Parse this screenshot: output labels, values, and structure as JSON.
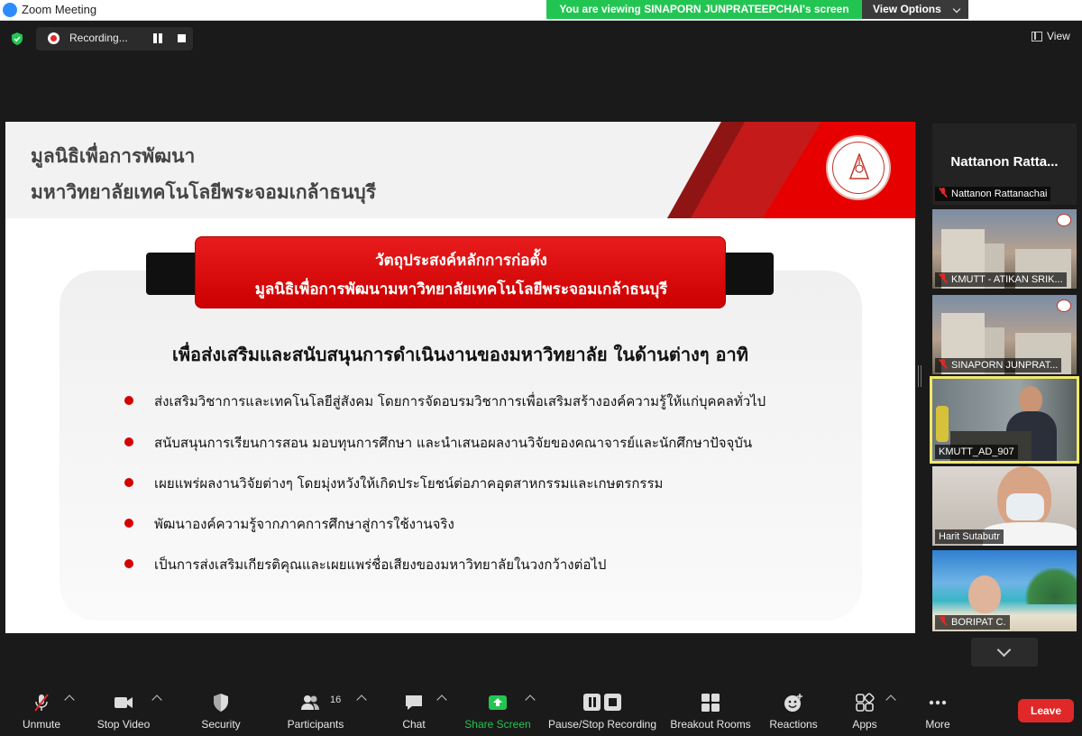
{
  "window": {
    "title": "Zoom Meeting"
  },
  "banner": {
    "viewing_text": "You are viewing SINAPORN   JUNPRATEEPCHAI's screen",
    "view_options_label": "View Options"
  },
  "recording": {
    "label": "Recording..."
  },
  "top_right": {
    "view_label": "View"
  },
  "slide": {
    "header_line1": "มูลนิธิเพื่อการพัฒนา",
    "header_line2": "มหาวิทยาลัยเทคโนโลยีพระจอมเกล้าธนบุรี",
    "red_line1": "วัตถุประสงค์หลักการก่อตั้ง",
    "red_line2": "มูลนิธิเพื่อการพัฒนามหาวิทยาลัยเทคโนโลยีพระจอมเกล้าธนบุรี",
    "lead": "เพื่อส่งเสริมและสนับสนุนการดำเนินงานของมหาวิทยาลัย ในด้านต่างๆ อาทิ",
    "bullets": [
      "ส่งเสริมวิชาการและเทคโนโลยีสู่สังคม โดยการจัดอบรมวิชาการเพื่อเสริมสร้างองค์ความรู้ให้แก่บุคคลทั่วไป",
      "สนับสนุนการเรียนการสอน มอบทุนการศึกษา และนำเสนอผลงานวิจัยของคณาจารย์และนักศึกษาปัจจุบัน",
      "เผยแพร่ผลงานวิจัยต่างๆ โดยมุ่งหวังให้เกิดประโยชน์ต่อภาคอุตสาหกรรมและเกษตรกรรม",
      "พัฒนาองค์ความรู้จากภาคการศึกษาสู่การใช้งานจริง",
      "เป็นการส่งเสริมเกียรติคุณและเผยแพร่ชื่อเสียงของมหาวิทยาลัยในวงกว้างต่อไป"
    ]
  },
  "participants": [
    {
      "big_name": "Nattanon   Ratta...",
      "name": "Nattanon Rattanachai",
      "muted": true
    },
    {
      "name": "KMUTT - ATIKAN SRIK...",
      "muted": true
    },
    {
      "name": "SINAPORN    JUNPRAT...",
      "muted": true
    },
    {
      "name": "KMUTT_AD_907",
      "muted": false
    },
    {
      "name": "Harit Sutabutr",
      "muted": false
    },
    {
      "name": "BORIPAT C.",
      "muted": true
    }
  ],
  "toolbar": {
    "unmute": "Unmute",
    "stop_video": "Stop Video",
    "security": "Security",
    "participants": "Participants",
    "participants_count": "16",
    "chat": "Chat",
    "share_screen": "Share Screen",
    "pause_stop_recording": "Pause/Stop Recording",
    "breakout_rooms": "Breakout Rooms",
    "reactions": "Reactions",
    "apps": "Apps",
    "more": "More",
    "leave": "Leave"
  },
  "colors": {
    "share_green": "#23c552",
    "leave_red": "#e02828",
    "slide_red": "#e00000",
    "active_speaker": "#f0e86a"
  }
}
